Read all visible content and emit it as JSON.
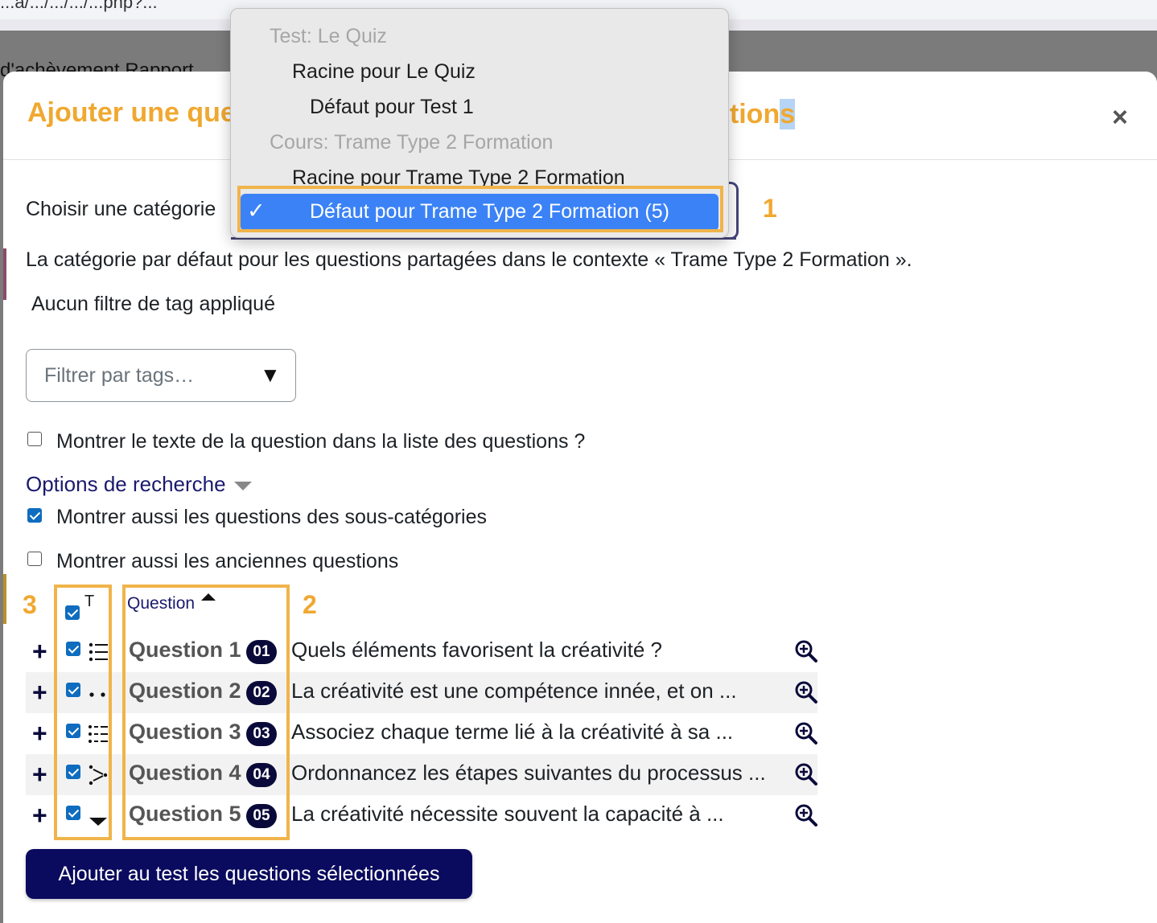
{
  "background": {
    "url_fragment": "...a/.../.../.../...php?...",
    "nav_text": "d'achèvement   Rapport"
  },
  "modal": {
    "title_visible": "Ajouter une que",
    "title_tail_visible": "stion",
    "title_tail_selected": "s",
    "close_label": "×"
  },
  "category": {
    "label": "Choisir une catégorie",
    "description": "La catégorie par défaut pour les questions partagées dans le contexte « Trame Type 2 Formation ».",
    "dropdown": [
      {
        "kind": "group",
        "label": "Test: Le Quiz"
      },
      {
        "kind": "option",
        "label": "Racine pour Le Quiz",
        "level": 1
      },
      {
        "kind": "option",
        "label": "Défaut pour Test 1",
        "level": 2
      },
      {
        "kind": "group",
        "label": "Cours: Trame Type 2 Formation"
      },
      {
        "kind": "option",
        "label": "Racine pour Trame Type 2 Formation",
        "level": 1
      }
    ],
    "selected": {
      "check": "✓",
      "label": "Défaut pour Trame Type 2 Formation (5)"
    }
  },
  "tags": {
    "no_filter": "Aucun filtre de tag appliqué",
    "placeholder": "Filtrer par tags…",
    "caret": "▼"
  },
  "options": {
    "show_text_label": "Montrer le texte de la question dans la liste des questions ?",
    "show_text_checked": false,
    "search_options_label": "Options de recherche",
    "subcategories_label": "Montrer aussi les questions des sous-catégories",
    "subcategories_checked": true,
    "old_questions_label": "Montrer aussi les anciennes questions",
    "old_questions_checked": false
  },
  "annotations": [
    "1",
    "2",
    "3"
  ],
  "table": {
    "col_type": "T",
    "col_question": "Question",
    "sort": "ascending",
    "rows": [
      {
        "add": "+",
        "checked": true,
        "type_icon": "multichoice-icon",
        "name": "Question 1",
        "badge": "01",
        "text": "Quels éléments favorisent la créativité ?"
      },
      {
        "add": "+",
        "checked": true,
        "type_icon": "truefalse-icon",
        "name": "Question 2",
        "badge": "02",
        "text": "La créativité est une compétence innée, et on ..."
      },
      {
        "add": "+",
        "checked": true,
        "type_icon": "matching-icon",
        "name": "Question 3",
        "badge": "03",
        "text": "Associez chaque terme lié à la créativité à sa ..."
      },
      {
        "add": "+",
        "checked": true,
        "type_icon": "ordering-icon",
        "name": "Question 4",
        "badge": "04",
        "text": "Ordonnancez les étapes suivantes du processus ..."
      },
      {
        "add": "+",
        "checked": true,
        "type_icon": "select-missing-words-icon",
        "name": "Question 5",
        "badge": "05",
        "text": "La créativité nécessite souvent la capacité à ..."
      }
    ]
  },
  "add_button": "Ajouter au test les questions sélectionnées",
  "colors": {
    "title": "#f0a830",
    "annotation": "#f0b44a",
    "primary": "#0a0a5e",
    "checkbox": "#0f6cbf",
    "selection": "#3b82f6"
  }
}
